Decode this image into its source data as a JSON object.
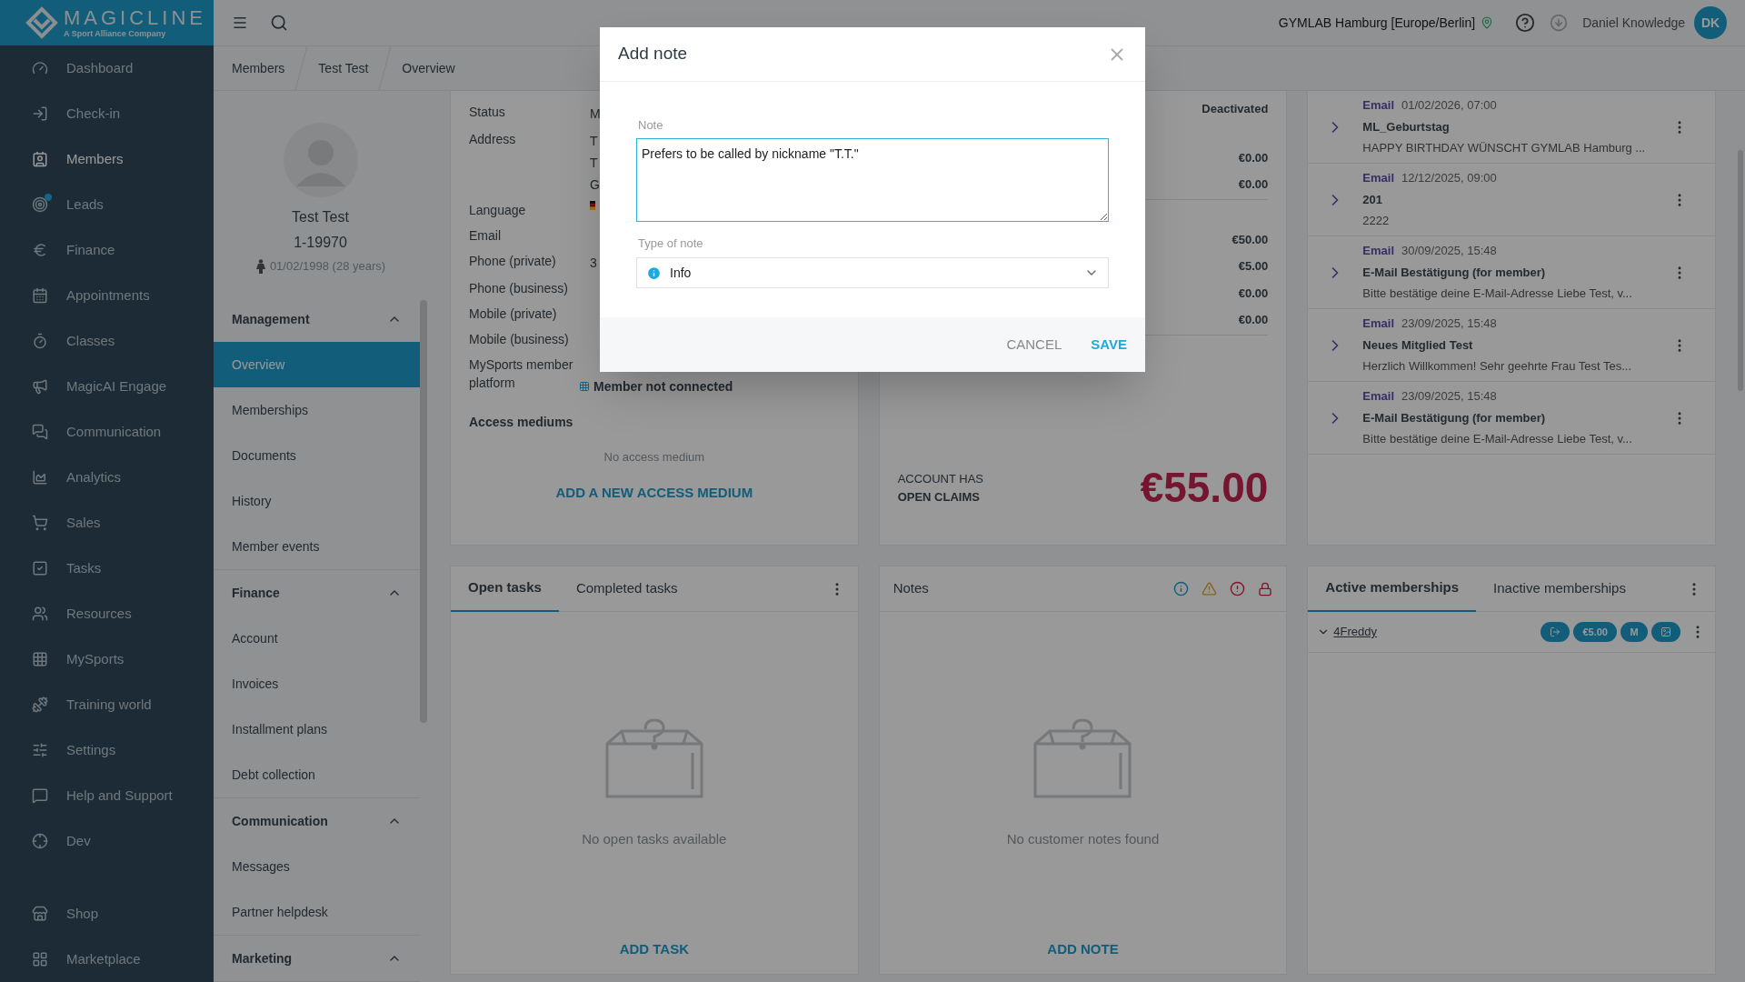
{
  "brand": {
    "name": "MAGICLINE",
    "tagline": "A Sport Alliance Company"
  },
  "nav_items": [
    {
      "label": "Dashboard",
      "selected": false,
      "notification": false
    },
    {
      "label": "Check-in",
      "selected": false,
      "notification": false
    },
    {
      "label": "Members",
      "selected": true,
      "notification": false
    },
    {
      "label": "Leads",
      "selected": false,
      "notification": true
    },
    {
      "label": "Finance",
      "selected": false,
      "notification": false
    },
    {
      "label": "Appointments",
      "selected": false,
      "notification": false
    },
    {
      "label": "Classes",
      "selected": false,
      "notification": false
    },
    {
      "label": "MagicAI Engage",
      "selected": false,
      "notification": false
    },
    {
      "label": "Communication",
      "selected": false,
      "notification": false
    },
    {
      "label": "Analytics",
      "selected": false,
      "notification": false
    },
    {
      "label": "Sales",
      "selected": false,
      "notification": false
    },
    {
      "label": "Tasks",
      "selected": false,
      "notification": false
    },
    {
      "label": "Resources",
      "selected": false,
      "notification": false
    },
    {
      "label": "MySports",
      "selected": false,
      "notification": false
    },
    {
      "label": "Training world",
      "selected": false,
      "notification": false
    },
    {
      "label": "Settings",
      "selected": false,
      "notification": false
    },
    {
      "label": "Help and Support",
      "selected": false,
      "notification": false
    },
    {
      "label": "Dev",
      "selected": false,
      "notification": false
    }
  ],
  "nav_bottom_items": [
    {
      "label": "Shop",
      "selected": false,
      "notification": false
    },
    {
      "label": "Marketplace",
      "selected": false,
      "notification": false
    }
  ],
  "header": {
    "location": "GYMLAB Hamburg [Europe/Berlin]",
    "user": "Daniel Knowledge",
    "initials": "DK"
  },
  "breadcrumbs": [
    "Members",
    "Test Test",
    "Overview"
  ],
  "profile": {
    "name": "Test Test",
    "number": "1-19970",
    "birth": "01/02/1998 (28 years)"
  },
  "member_menu": [
    {
      "title": "Management",
      "expanded": true,
      "items": [
        {
          "label": "Overview",
          "selected": true
        },
        {
          "label": "Memberships",
          "selected": false
        },
        {
          "label": "Documents",
          "selected": false
        },
        {
          "label": "History",
          "selected": false
        },
        {
          "label": "Member events",
          "selected": false
        }
      ]
    },
    {
      "title": "Finance",
      "expanded": true,
      "items": [
        {
          "label": "Account",
          "selected": false
        },
        {
          "label": "Invoices",
          "selected": false
        },
        {
          "label": "Installment plans",
          "selected": false
        },
        {
          "label": "Debt collection",
          "selected": false
        }
      ]
    },
    {
      "title": "Communication",
      "expanded": true,
      "items": [
        {
          "label": "Messages",
          "selected": false
        },
        {
          "label": "Partner helpdesk",
          "selected": false
        }
      ]
    },
    {
      "title": "Marketing",
      "expanded": true
    }
  ],
  "details": {
    "fields": [
      {
        "kind": "text",
        "label": "Status",
        "lines": [
          "M"
        ]
      },
      {
        "kind": "text",
        "label": "Address",
        "lines": [
          "T",
          "T",
          "G"
        ]
      },
      {
        "kind": "flag",
        "label": "Language"
      },
      {
        "kind": "text",
        "label": "Email"
      },
      {
        "kind": "text",
        "label": "Phone (private)",
        "lines": [
          "3"
        ]
      },
      {
        "kind": "text",
        "label": "Phone (business)"
      },
      {
        "kind": "text",
        "label": "Mobile (private)"
      },
      {
        "kind": "text",
        "label": "Mobile (business)"
      },
      {
        "kind": "mysports",
        "label": "MySports member platform",
        "lines": [
          "Member not connected"
        ]
      }
    ],
    "access_title": "Access mediums",
    "access_empty": "No access medium",
    "access_action": "ADD A NEW ACCESS MEDIUM"
  },
  "account": {
    "status": "Deactivated",
    "groups": [
      [
        "€0.00",
        "€0.00"
      ],
      [
        "€50.00",
        "€5.00",
        "€0.00",
        "€0.00"
      ]
    ],
    "claims_line1": "ACCOUNT HAS",
    "claims_line2": "OPEN CLAIMS",
    "claims_amount": "€55.00"
  },
  "messages": [
    {
      "type": "Email",
      "datetime": "01/02/2026, 07:00",
      "subject": "ML_Geburtstag",
      "preview": "HAPPY BIRTHDAY WÜNSCHT GYMLAB Hamburg ..."
    },
    {
      "type": "Email",
      "datetime": "12/12/2025, 09:00",
      "subject": "201",
      "preview": "2222"
    },
    {
      "type": "Email",
      "datetime": "30/09/2025, 15:48",
      "subject": "E-Mail Bestätigung (for member)",
      "preview": "Bitte bestätige deine E-Mail-Adresse Liebe Test, v..."
    },
    {
      "type": "Email",
      "datetime": "23/09/2025, 15:48",
      "subject": "Neues Mitglied Test",
      "preview": "Herzlich Willkommen! Sehr geehrte Frau Test Tes..."
    },
    {
      "type": "Email",
      "datetime": "23/09/2025, 15:48",
      "subject": "E-Mail Bestätigung (for member)",
      "preview": "Bitte bestätige deine E-Mail-Adresse Liebe Test, v..."
    }
  ],
  "tasks": {
    "tabs": [
      {
        "label": "Open tasks",
        "selected": true
      },
      {
        "label": "Completed tasks",
        "selected": false
      }
    ],
    "empty": "No open tasks available",
    "action": "ADD TASK"
  },
  "notes": {
    "title": "Notes",
    "empty": "No customer notes found",
    "action": "ADD NOTE"
  },
  "memberships": {
    "tabs": [
      {
        "label": "Active memberships",
        "selected": true
      },
      {
        "label": "Inactive memberships",
        "selected": false
      }
    ],
    "items": [
      {
        "name": "4Freddy",
        "expanded": true,
        "price": "€5.00",
        "letter": "M"
      }
    ]
  },
  "dialog": {
    "title": "Add note",
    "note_label": "Note",
    "note_value": "Prefers to be called by nickname \"T.T.\"",
    "type_label": "Type of note",
    "type_value": "Info",
    "cancel": "CANCEL",
    "save": "SAVE"
  }
}
